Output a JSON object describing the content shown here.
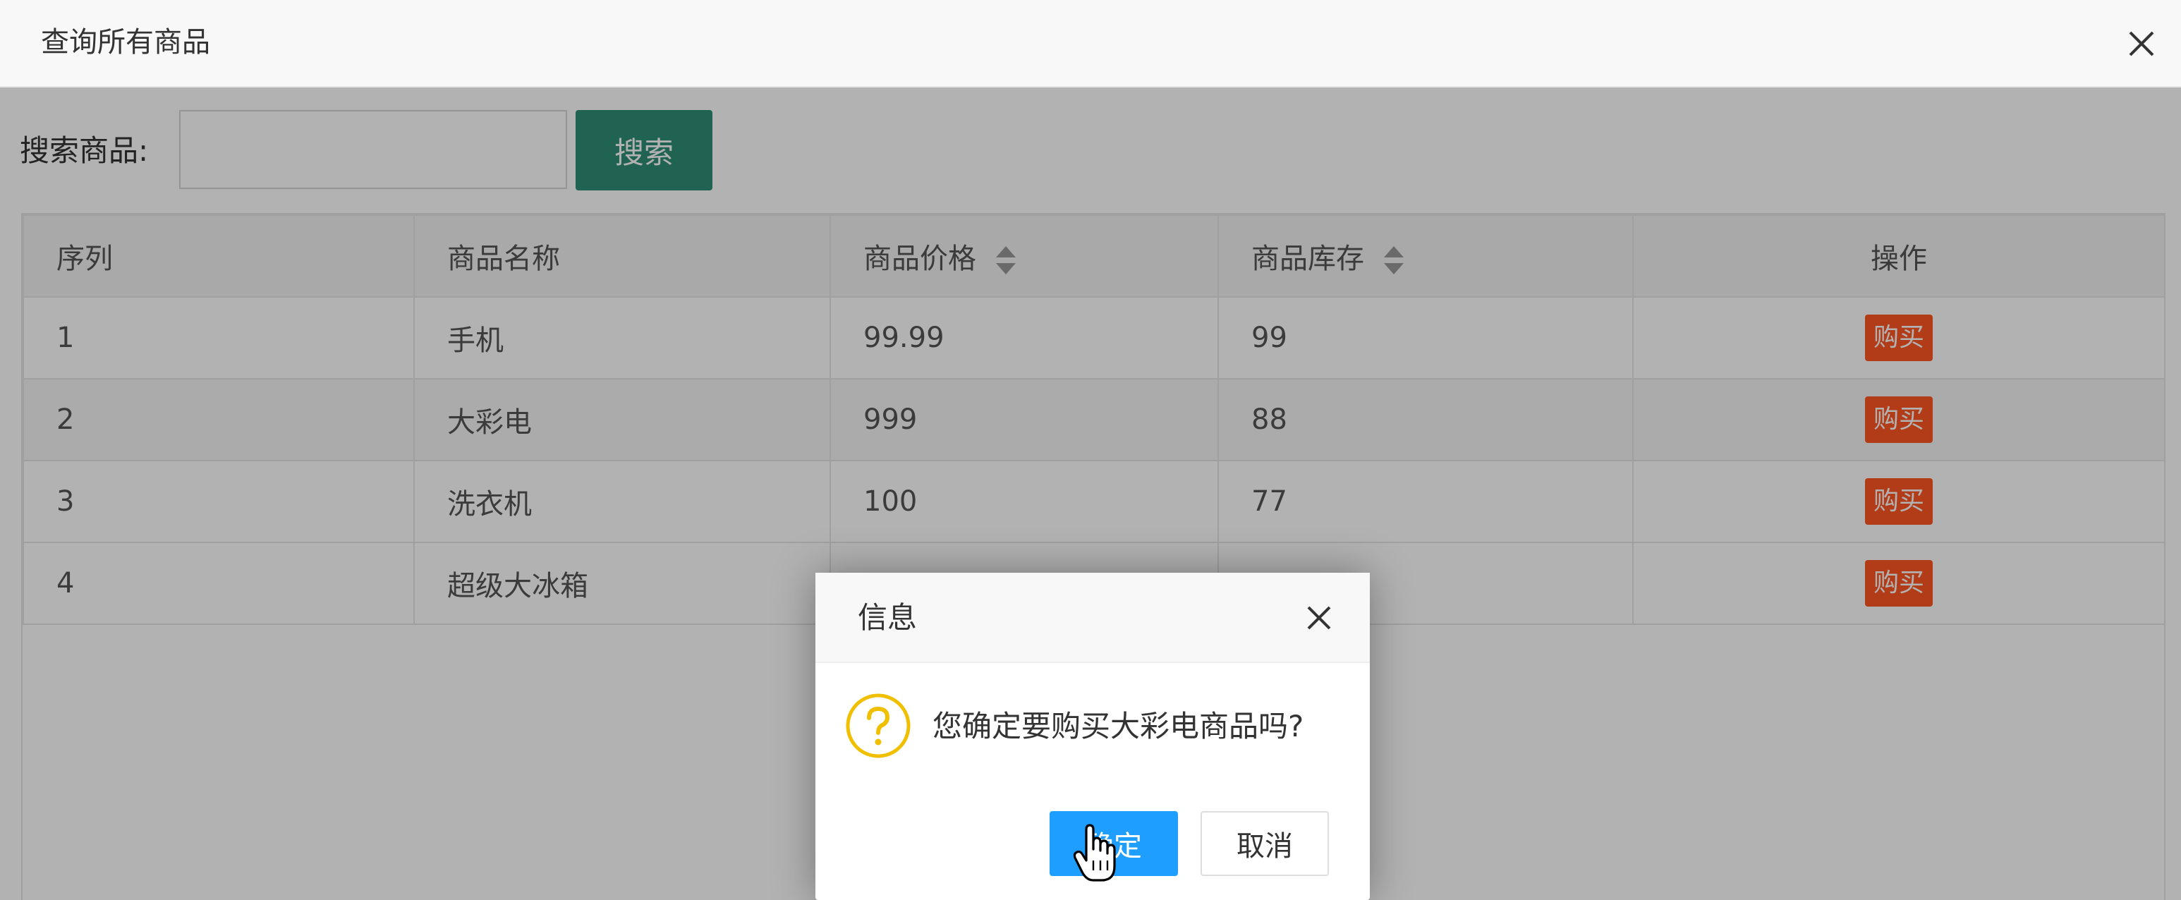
{
  "window": {
    "title": "查询所有商品",
    "close_icon": "close-icon"
  },
  "search": {
    "label": "搜索商品:",
    "value": "",
    "placeholder": "",
    "button_label": "搜索"
  },
  "table": {
    "headers": {
      "index": "序列",
      "name": "商品名称",
      "price": "商品价格",
      "stock": "商品库存",
      "ops": "操作"
    },
    "rows": [
      {
        "index": "1",
        "name": "手机",
        "price": "99.99",
        "stock": "99",
        "action": "购买"
      },
      {
        "index": "2",
        "name": "大彩电",
        "price": "999",
        "stock": "88",
        "action": "购买"
      },
      {
        "index": "3",
        "name": "洗衣机",
        "price": "100",
        "stock": "77",
        "action": "购买"
      },
      {
        "index": "4",
        "name": "超级大冰箱",
        "price": "",
        "stock": "",
        "action": "购买"
      }
    ]
  },
  "dialog": {
    "title": "信息",
    "message": "您确定要购买大彩电商品吗?",
    "ok_label": "确定",
    "cancel_label": "取消",
    "icon": "question-icon"
  },
  "colors": {
    "search_button": "#2f8f77",
    "buy_button": "#ff5722",
    "ok_button": "#1e9fff",
    "question_icon": "#f0c000"
  }
}
